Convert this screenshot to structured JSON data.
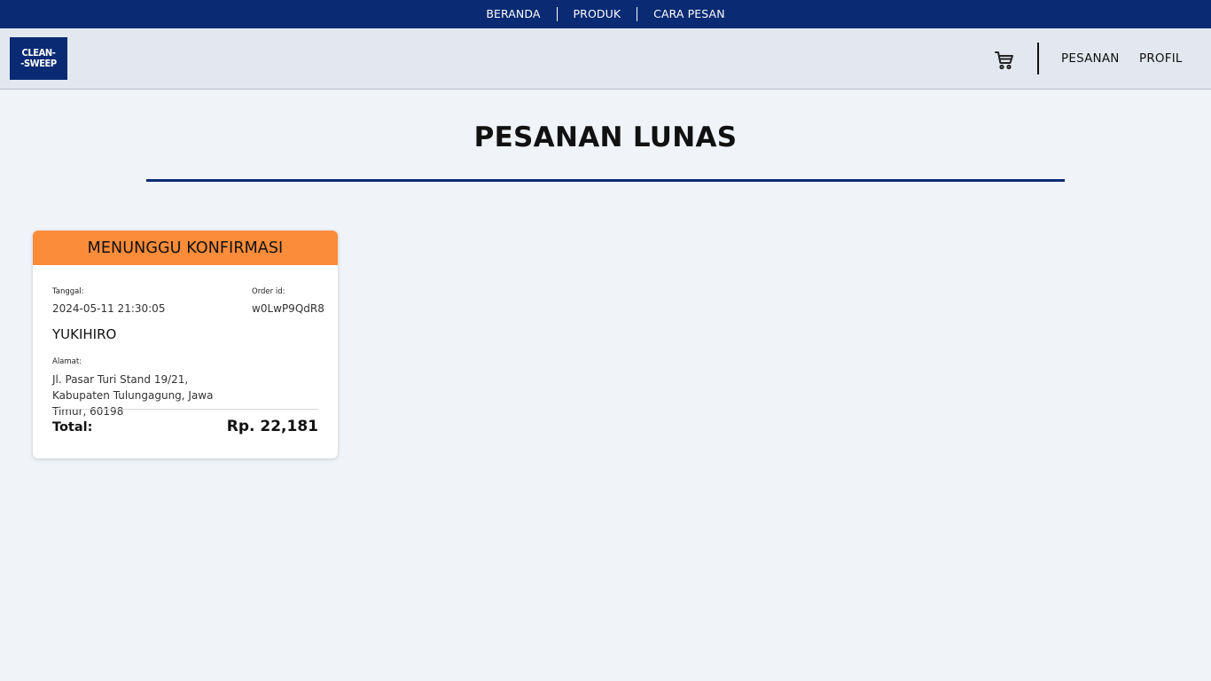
{
  "topnav": {
    "items": [
      "BERANDA",
      "PRODUK",
      "CARA PESAN"
    ]
  },
  "header": {
    "logo_line1": "CLEAN-",
    "logo_line2": "-SWEEP",
    "cart_icon": "shopping-cart-icon",
    "nav": [
      "PESANAN",
      "PROFIL"
    ]
  },
  "page": {
    "title": "PESANAN LUNAS"
  },
  "order": {
    "status": "MENUNGGU KONFIRMASI",
    "tanggal_label": "Tanggal:",
    "tanggal": "2024-05-11 21:30:05",
    "order_id_label": "Order id:",
    "order_id": "w0LwP9QdR8",
    "name": "YUKIHIRO",
    "alamat_label": "Alamat:",
    "alamat": "Jl. Pasar Turi Stand 19/21, Kabupaten Tulungagung, Jawa Timur, 60198",
    "total_label": "Total:",
    "total": "Rp. 22,181"
  },
  "colors": {
    "primary": "#0a2a73",
    "status_pending": "#fb8c3a",
    "background": "#f0f3f8"
  }
}
